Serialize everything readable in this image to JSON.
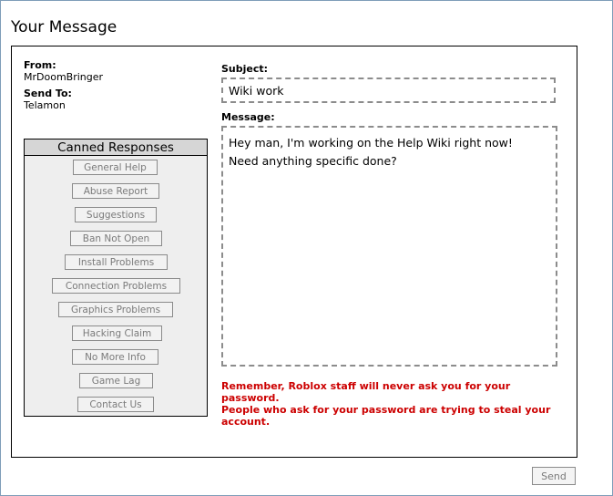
{
  "page": {
    "title": "Your Message"
  },
  "from": {
    "label": "From:",
    "value": "MrDoomBringer"
  },
  "send_to": {
    "label": "Send To:",
    "value": "Telamon"
  },
  "canned": {
    "title": "Canned Responses",
    "items": [
      "General Help",
      "Abuse Report",
      "Suggestions",
      "Ban Not Open",
      "Install Problems",
      "Connection Problems",
      "Graphics Problems",
      "Hacking Claim",
      "No More Info",
      "Game Lag",
      "Contact Us"
    ]
  },
  "subject": {
    "label": "Subject:",
    "value": "Wiki work"
  },
  "message": {
    "label": "Message:",
    "value": "Hey man, I'm working on the Help Wiki right now!\nNeed anything specific done?"
  },
  "warning": {
    "line1": "Remember, Roblox staff will never ask you for your password.",
    "line2": "People who ask for your password are trying to steal your account."
  },
  "actions": {
    "send_label": "Send"
  }
}
